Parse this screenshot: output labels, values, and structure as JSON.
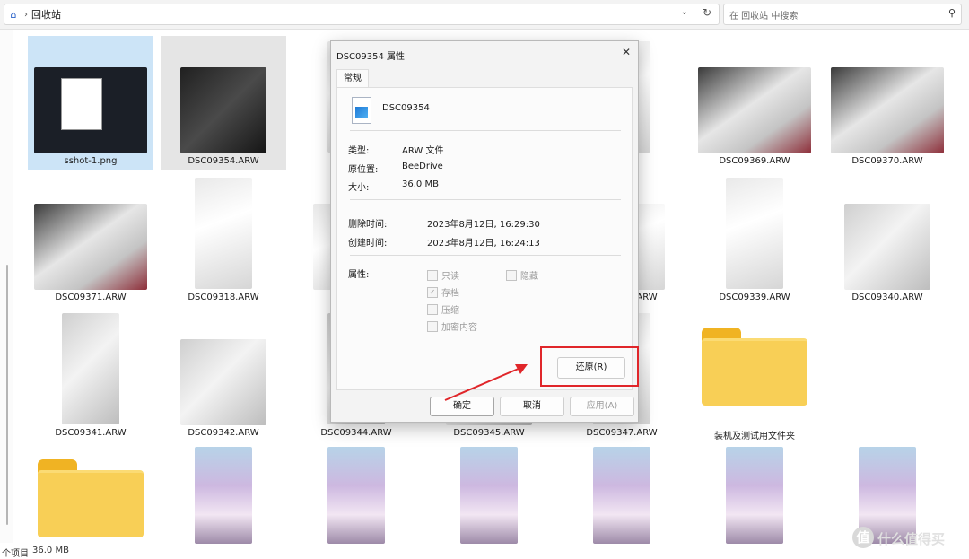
{
  "address": {
    "location": "回收站"
  },
  "search": {
    "placeholder": "在 回收站 中搜索"
  },
  "files": [
    {
      "name": "sshot-1.png",
      "kind": "shot",
      "selected": true
    },
    {
      "name": "DSC09354.ARW",
      "kind": "dark",
      "hovered": true
    },
    {
      "name": "D",
      "kind": "white"
    },
    {
      "name": "",
      "kind": "gray"
    },
    {
      "name": "ARW",
      "kind": "white"
    },
    {
      "name": "DSC09369.ARW",
      "kind": "mix"
    },
    {
      "name": "DSC09370.ARW",
      "kind": "mix"
    },
    {
      "name": "DSC09371.ARW",
      "kind": "mix"
    },
    {
      "name": "DSC09318.ARW",
      "kind": "white"
    },
    {
      "name": "D",
      "kind": "white"
    },
    {
      "name": "ARW",
      "kind": "white"
    },
    {
      "name": "DSC09338.ARW",
      "kind": "white"
    },
    {
      "name": "DSC09339.ARW",
      "kind": "white"
    },
    {
      "name": "DSC09340.ARW",
      "kind": "gray"
    },
    {
      "name": "DSC09341.ARW",
      "kind": "gray"
    },
    {
      "name": "DSC09342.ARW",
      "kind": "gray"
    },
    {
      "name": "DSC09344.ARW",
      "kind": "gray"
    },
    {
      "name": "DSC09345.ARW",
      "kind": "gray"
    },
    {
      "name": "DSC09347.ARW",
      "kind": "white"
    },
    {
      "name": "装机及测试用文件夹",
      "kind": "folder"
    }
  ],
  "bottom_row": [
    {
      "kind": "folder"
    },
    {
      "kind": "cos"
    },
    {
      "kind": "cos"
    },
    {
      "kind": "cos"
    },
    {
      "kind": "cos"
    },
    {
      "kind": "cos"
    },
    {
      "kind": "cos"
    }
  ],
  "status": {
    "items_text": "个项目",
    "selection_text": "36.0 MB"
  },
  "watermark": {
    "text": "什么值得买",
    "logo_char": "值"
  },
  "dialog": {
    "title": "DSC09354 属性",
    "tab": "常规",
    "filename": "DSC09354",
    "type_label": "类型:",
    "type_value": "ARW 文件",
    "origin_label": "原位置:",
    "origin_value": "BeeDrive",
    "size_label": "大小:",
    "size_value": "36.0 MB",
    "deleted_label": "删除时间:",
    "deleted_value": "2023年8月12日, 16:29:30",
    "created_label": "创建时间:",
    "created_value": "2023年8月12日, 16:24:13",
    "attributes_label": "属性:",
    "attributes": [
      {
        "label": "只读",
        "checked": false
      },
      {
        "label": "隐藏",
        "checked": false
      },
      {
        "label": "存档",
        "checked": true
      },
      {
        "label": "压缩",
        "checked": false
      },
      {
        "label": "加密内容",
        "checked": false
      }
    ],
    "restore": "还原(R)",
    "ok": "确定",
    "cancel": "取消",
    "apply": "应用(A)"
  },
  "icons": {
    "home": "home-icon",
    "close": "close-icon",
    "search": "search-icon",
    "refresh": "refresh-icon"
  }
}
